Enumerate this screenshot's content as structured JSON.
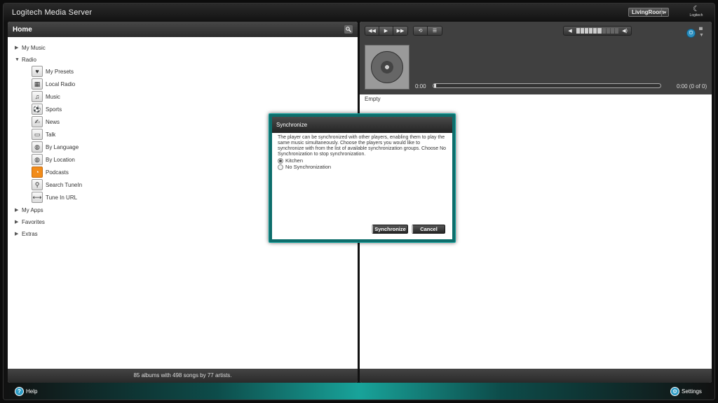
{
  "app": {
    "title": "Logitech Media Server",
    "logo_text": "Logitech"
  },
  "player": {
    "selected": "LivingRoom"
  },
  "left_panel": {
    "title": "Home",
    "items": [
      {
        "label": "My Music",
        "expanded": false
      },
      {
        "label": "Radio",
        "expanded": true
      },
      {
        "label": "My Apps",
        "expanded": false
      },
      {
        "label": "Favorites",
        "expanded": false
      },
      {
        "label": "Extras",
        "expanded": false
      }
    ],
    "radio_items": [
      {
        "label": "My Presets",
        "icon": "heart-icon",
        "glyph": "♥"
      },
      {
        "label": "Local Radio",
        "icon": "local-radio-icon",
        "glyph": "▦"
      },
      {
        "label": "Music",
        "icon": "music-note-icon",
        "glyph": "♫"
      },
      {
        "label": "Sports",
        "icon": "soccer-ball-icon",
        "glyph": "⚽"
      },
      {
        "label": "News",
        "icon": "news-icon",
        "glyph": "✍"
      },
      {
        "label": "Talk",
        "icon": "speech-bubble-icon",
        "glyph": "▭"
      },
      {
        "label": "By Language",
        "icon": "globe-icon",
        "glyph": "◍"
      },
      {
        "label": "By Location",
        "icon": "globe-location-icon",
        "glyph": "◍"
      },
      {
        "label": "Podcasts",
        "icon": "rss-icon",
        "glyph": "◔"
      },
      {
        "label": "Search TuneIn",
        "icon": "magnifier-icon",
        "glyph": "⚲"
      },
      {
        "label": "Tune In URL",
        "icon": "url-icon",
        "glyph": "⟷"
      }
    ],
    "footer": "85 albums with 498 songs by 77 artists."
  },
  "player_panel": {
    "time_elapsed": "0:00",
    "time_total": "0:00  (0 of 0)",
    "playlist_status": "Empty",
    "progress_fraction": 0,
    "volume_level": 6,
    "volume_max": 10
  },
  "modal": {
    "title": "Synchronize",
    "description": "The player can be synchronized with other players, enabling them to play the same music simultaneously. Choose the players you would like to synchronize with from the list of available synchronization groups. Choose No Synchronization to stop synchronization.",
    "options": [
      {
        "label": "Kitchen",
        "selected": true
      },
      {
        "label": "No Synchronization",
        "selected": false
      }
    ],
    "synchronize_label": "Synchronize",
    "cancel_label": "Cancel"
  },
  "bottom": {
    "help_label": "Help",
    "settings_label": "Settings"
  }
}
